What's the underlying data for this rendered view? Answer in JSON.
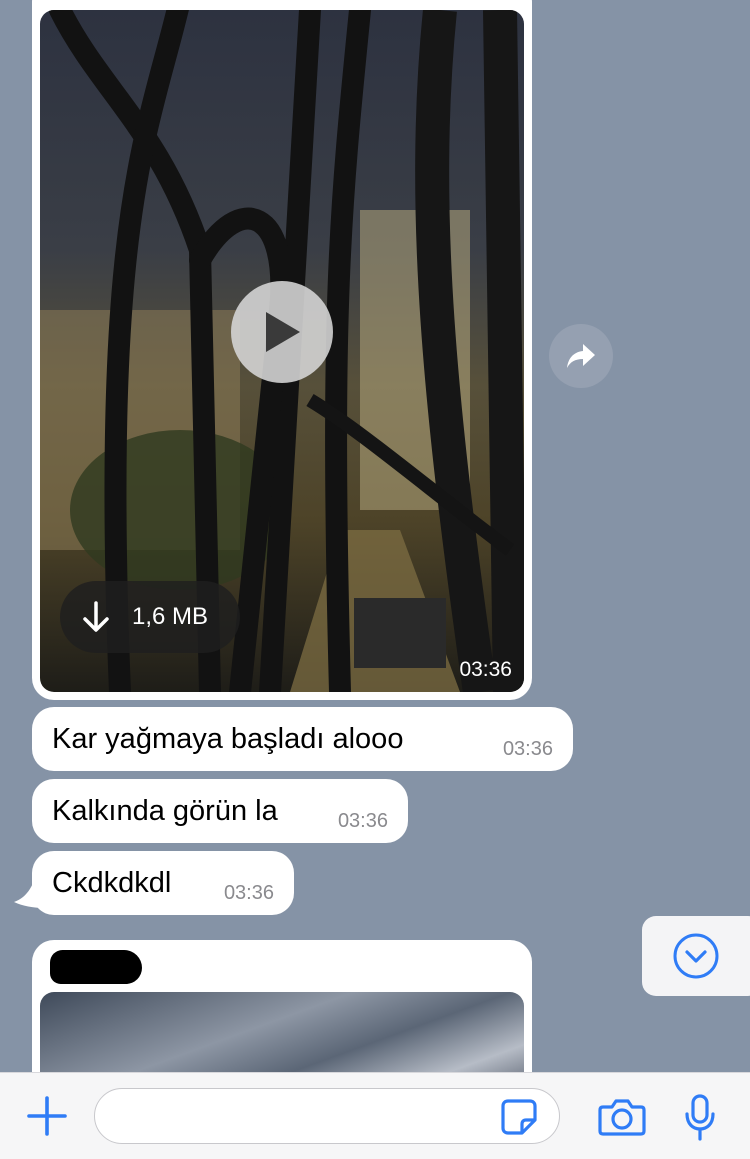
{
  "video_message": {
    "download_size": "1,6 MB",
    "time": "03:36"
  },
  "messages": [
    {
      "text": "Kar yağmaya başladı alooo",
      "time": "03:36"
    },
    {
      "text": "Kalkında görün la",
      "time": "03:36"
    },
    {
      "text": "Ckdkdkdl",
      "time": "03:36"
    }
  ],
  "icons": {
    "play": "play-icon",
    "download": "download-arrow-icon",
    "forward": "forward-icon",
    "scroll_down": "chevron-down-icon",
    "attach": "plus-icon",
    "sticker": "sticker-icon",
    "camera": "camera-icon",
    "mic": "microphone-icon"
  },
  "composer": {
    "value": "",
    "placeholder": ""
  },
  "colors": {
    "chat_background": "#8593a6",
    "accent": "#2f7cf6",
    "bubble": "#ffffff"
  }
}
